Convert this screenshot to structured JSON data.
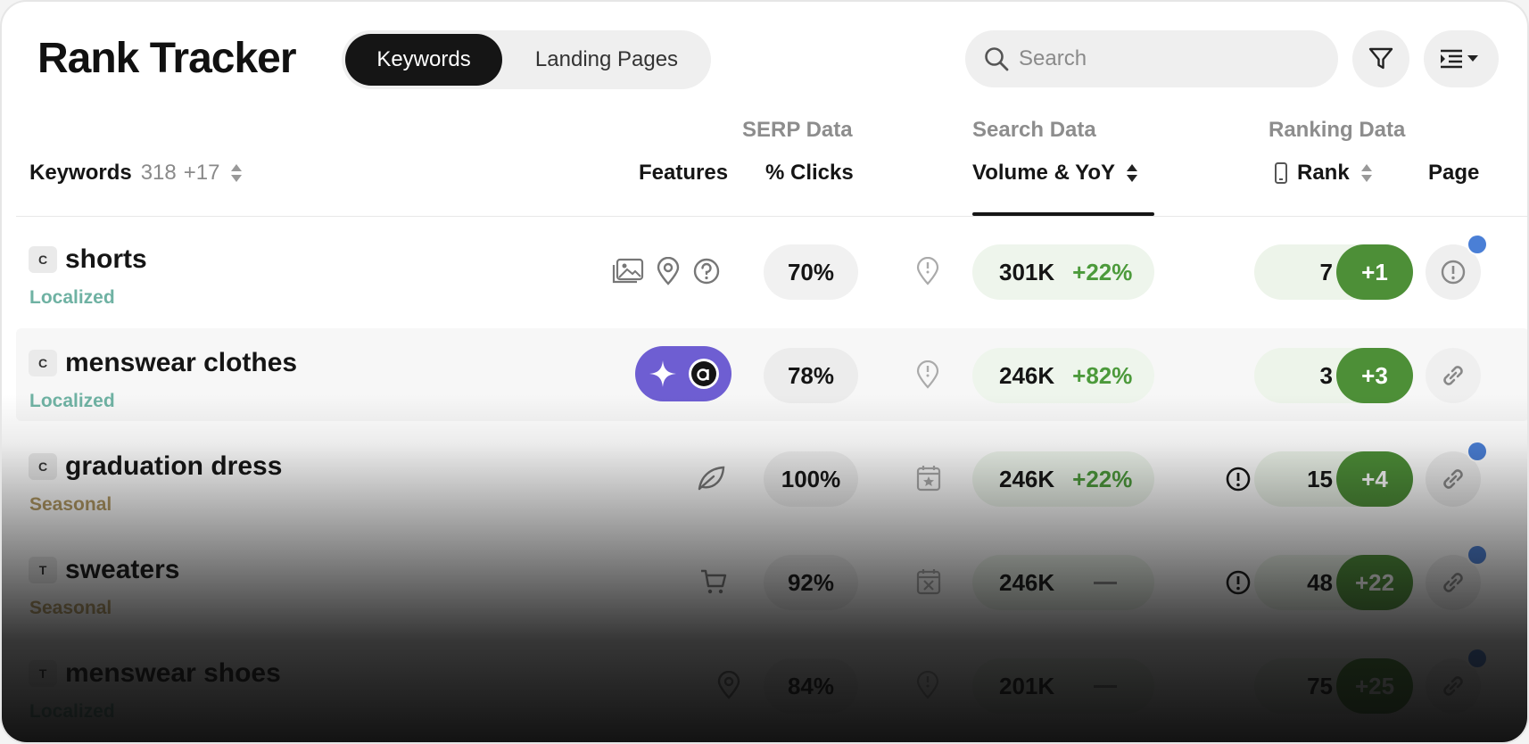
{
  "app": {
    "title": "Rank Tracker"
  },
  "tabs": [
    {
      "label": "Keywords",
      "active": true
    },
    {
      "label": "Landing Pages",
      "active": false
    }
  ],
  "search": {
    "placeholder": "Search"
  },
  "toolbar": {
    "filter_icon": "filter-icon",
    "view_icon": "view-options-icon"
  },
  "groups": {
    "serp": "SERP Data",
    "search": "Search Data",
    "ranking": "Ranking Data"
  },
  "columns": {
    "keywords": "Keywords",
    "keywords_count": "318",
    "keywords_delta": "+17",
    "features": "Features",
    "clicks": "% Clicks",
    "volume": "Volume & YoY",
    "rank": "Rank",
    "page": "Page"
  },
  "colors": {
    "accent_green": "#4d8f37",
    "localized": "#6fb2a3",
    "seasonal": "#b39a63",
    "ai_purple": "#6e5ed2",
    "dot_blue": "#4a7fd6"
  },
  "rows": [
    {
      "type": "C",
      "keyword": "shorts",
      "tag": "Localized",
      "features": [
        "image-pack-icon",
        "map-pin-icon",
        "question-icon"
      ],
      "clicks": "70%",
      "serp_icon": "pin-alert-icon",
      "volume": "301K",
      "yoy": "+22%",
      "alert": false,
      "rank": "7",
      "delta": "+1",
      "page_icon": "alert-icon",
      "dot": true
    },
    {
      "type": "C",
      "keyword": "menswear clothes",
      "tag": "Localized",
      "features": [
        "ai-sparkle-icon",
        "ai-overview-icon"
      ],
      "clicks": "78%",
      "serp_icon": "pin-alert-icon",
      "volume": "246K",
      "yoy": "+82%",
      "alert": false,
      "rank": "3",
      "delta": "+3",
      "page_icon": "link-icon",
      "dot": false
    },
    {
      "type": "C",
      "keyword": "graduation dress",
      "tag": "Seasonal",
      "features": [
        "leaf-icon"
      ],
      "clicks": "100%",
      "serp_icon": "calendar-star-icon",
      "volume": "246K",
      "yoy": "+22%",
      "alert": true,
      "rank": "15",
      "delta": "+4",
      "page_icon": "link-icon",
      "dot": true
    },
    {
      "type": "T",
      "keyword": "sweaters",
      "tag": "Seasonal",
      "features": [
        "cart-icon"
      ],
      "clicks": "92%",
      "serp_icon": "calendar-x-icon",
      "volume": "246K",
      "yoy": "",
      "alert": true,
      "rank": "48",
      "delta": "+22",
      "page_icon": "link-icon",
      "dot": true
    },
    {
      "type": "T",
      "keyword": "menswear shoes",
      "tag": "Localized",
      "features": [
        "map-pin-icon"
      ],
      "clicks": "84%",
      "serp_icon": "pin-alert-icon",
      "volume": "201K",
      "yoy": "",
      "alert": false,
      "rank": "75",
      "delta": "+25",
      "page_icon": "link-icon",
      "dot": true
    }
  ]
}
